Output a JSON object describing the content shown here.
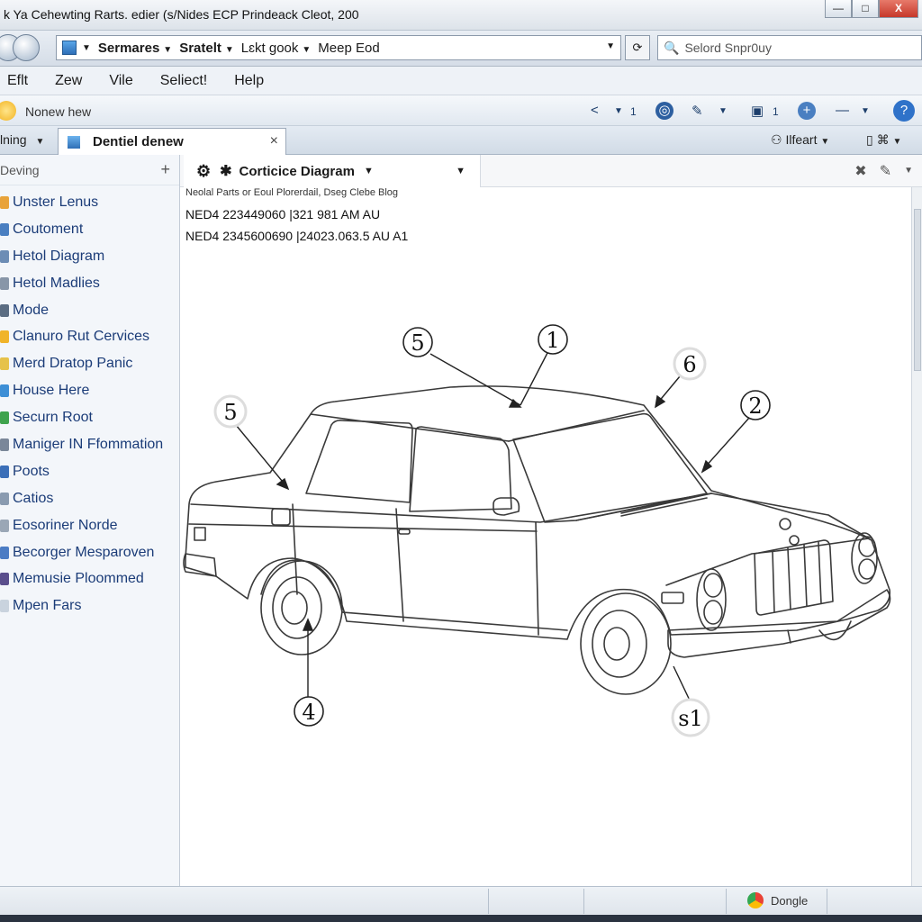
{
  "window": {
    "title": "k Ya Cehewting Rarts. edier (s/Nides ECP Prindeack Cleot, 200",
    "controls": [
      "—",
      "□",
      "X"
    ]
  },
  "address_bar": {
    "segments": [
      "Sermares",
      "Sratelt",
      "Lɛkt gook",
      "Meep Eod"
    ],
    "search_placeholder": "Selord Snpr0uy"
  },
  "menu": [
    "Eflt",
    "Zew",
    "Vile",
    "Seliect!",
    "Help"
  ],
  "favorites": {
    "label": "Nonew hew"
  },
  "command_bar": {
    "count_a": "1",
    "count_b": "1"
  },
  "tabs": {
    "left_label": "lning",
    "active_tab": "Dentiel denew",
    "close": "×",
    "right_label": "Ilfeart",
    "right_icon_text": "⌘"
  },
  "sidebar": {
    "header": "Deving",
    "add": "+",
    "items": [
      {
        "label": "Unster Lenus",
        "color": "#e8a33a"
      },
      {
        "label": "Coutoment",
        "color": "#4a7fc1"
      },
      {
        "label": "Hetol Diagram",
        "color": "#6d8db5"
      },
      {
        "label": "Hetol Madlies",
        "color": "#8896a8"
      },
      {
        "label": "Mode",
        "color": "#5b6d82"
      },
      {
        "label": "Clanuro Rut Cervices",
        "color": "#f0b42a"
      },
      {
        "label": "Merd Dratop Panic",
        "color": "#e6c24a"
      },
      {
        "label": "House Here",
        "color": "#3d8fd6"
      },
      {
        "label": "Securn Root",
        "color": "#3fa34d"
      },
      {
        "label": "Maniger IN Ffommation",
        "color": "#7a8799"
      },
      {
        "label": "Poots",
        "color": "#3b6fb8"
      },
      {
        "label": "Catios",
        "color": "#8a9bb0"
      },
      {
        "label": "Eosoriner Norde",
        "color": "#9aa7b6"
      },
      {
        "label": "Becorger Mesparoven",
        "color": "#4b7cc4"
      },
      {
        "label": "Memusie Ploommed",
        "color": "#5a4e8c"
      },
      {
        "label": "Mpen Fars",
        "color": "#c9d3de"
      }
    ]
  },
  "content": {
    "tab_label": "Corticice Diagram",
    "header_note": "Neolal Parts or Eoul Plorerdail, Dseg Clebe Blog",
    "lines": [
      "NED4  223449060  |321 981 AM AU",
      "NED4  2345600690  |24023.063.5 AU A1"
    ],
    "callouts": [
      "5",
      "1",
      "6",
      "5",
      "2",
      "4",
      "s1"
    ]
  },
  "status": {
    "zone": "Dongle"
  }
}
